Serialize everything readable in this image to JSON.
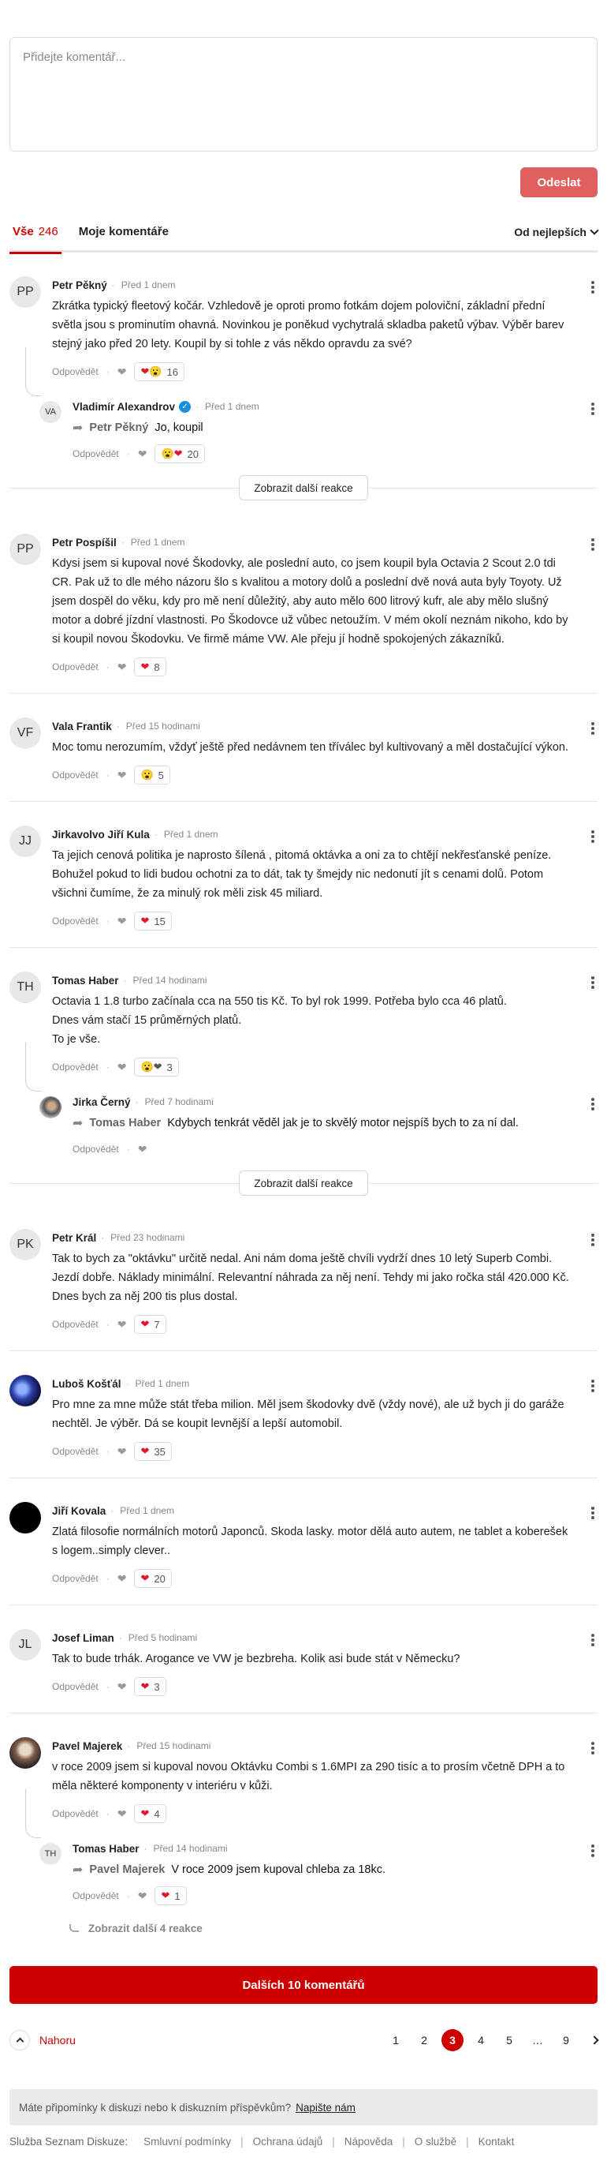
{
  "composer": {
    "placeholder": "Přidejte komentář...",
    "send_label": "Odeslat"
  },
  "tabs": {
    "all_label": "Vše",
    "all_count": "246",
    "mine_label": "Moje komentáře",
    "sort_label": "Od nejlepších"
  },
  "labels": {
    "reply": "Odpovědět",
    "more_reactions": "Zobrazit další reakce",
    "more_replies": "Zobrazit další 4 reakce"
  },
  "threads": [
    {
      "avatar": "PP",
      "name": "Petr Pěkný",
      "time": "Před 1 dnem",
      "text": "Zkrátka typický fleetový kočár. Vzhledově je oproti promo fotkám dojem poloviční, základní přední světla jsou s prominutím ohavná. Novinkou je poněkud vychytralá skladba paketů výbav. Výběr barev stejný jako před 20 lety. Koupil by si tohle z vás někdo opravdu za své?",
      "reaction_emoji": "❤😮",
      "reaction_count": "16",
      "reply": {
        "avatar": "VA",
        "name": "Vladimír Alexandrov",
        "time": "Před 1 dnem",
        "target": "Petr Pěkný",
        "text": "Jo, koupil",
        "reaction_emoji": "😮❤",
        "reaction_count": "20"
      }
    },
    {
      "avatar": "PP",
      "name": "Petr Pospíšil",
      "time": "Před 1 dnem",
      "text": "Kdysi jsem si kupoval nové Škodovky, ale poslední auto, co jsem koupil byla Octavia 2 Scout 2.0 tdi CR. Pak už to dle mého názoru šlo s kvalitou a motory dolů a poslední dvě nová auta byly Toyoty. Už jsem dospěl do věku, kdy pro mě není důležitý, aby auto mělo 600 litrový kufr, ale aby mělo slušný motor a dobré jízdní vlastnosti. Po Škodovce už vůbec netoužím. V mém okolí neznám nikoho, kdo by si koupil novou Škodovku. Ve firmě máme VW. Ale přeju jí hodně spokojených zákazníků.",
      "reaction_emoji": "❤",
      "reaction_count": "8"
    },
    {
      "avatar": "VF",
      "name": "Vala Frantik",
      "time": "Před 15 hodinami",
      "text": "Moc tomu nerozumím, vždyť ještě před nedávnem ten tříválec byl kultivovaný a měl dostačující výkon.",
      "reaction_emoji": "😮",
      "reaction_count": "5"
    },
    {
      "avatar": "JJ",
      "name": "Jirkavolvo Jiří Kula",
      "time": "Před 1 dnem",
      "text": "Ta jejich cenová politika je naprosto šílená , pitomá oktávka a oni za to chtějí nekřesťanské peníze. Bohužel pokud to lidi budou ochotni za to dát, tak ty šmejdy nic nedonutí jít s cenami dolů. Potom všichni čumíme, že za minulý rok měli zisk 45 miliard.",
      "reaction_emoji": "❤",
      "reaction_count": "15"
    },
    {
      "avatar": "TH",
      "name": "Tomas Haber",
      "time": "Před 14 hodinami",
      "text": "Octavia 1 1.8 turbo začínala cca na 550 tis Kč. To byl rok 1999. Potřeba bylo cca 46 platů.\nDnes vám stačí 15 průměrných platů.\nTo je vše.",
      "reaction_emoji": "😮❤",
      "reaction_count": "3",
      "reply": {
        "avatar": "",
        "name": "Jirka Černý",
        "time": "Před 7 hodinami",
        "target": "Tomas Haber",
        "text": "Kdybych tenkrát věděl jak je to skvělý motor nejspíš bych to za ní dal.",
        "reaction_emoji": "",
        "reaction_count": ""
      }
    },
    {
      "avatar": "PK",
      "name": "Petr Král",
      "time": "Před 23 hodinami",
      "text": "Tak to bych za \"oktávku\" určitě nedal. Ani nám doma ještě chvíli vydrží dnes 10 letý Superb Combi. Jezdí dobře. Náklady minimální. Relevantní náhrada za něj není. Tehdy mi jako ročka stál 420.000 Kč. Dnes bych za něj 200 tis plus dostal.",
      "reaction_emoji": "❤",
      "reaction_count": "7"
    },
    {
      "avatar": "",
      "name": "Luboš Košťál",
      "time": "Před 1 dnem",
      "text": "Pro mne za mne může stát třeba milion. Měl jsem škodovky dvě (vždy nové), ale už bych ji do garáže nechtěl. Je výběr. Dá se koupit levnější a lepší automobil.",
      "reaction_emoji": "❤",
      "reaction_count": "35"
    },
    {
      "avatar": "",
      "name": "Jiří Kovala",
      "time": "Před 1 dnem",
      "text": "Zlatá filosofie normálních motorů Japonců. Skoda lasky. motor dělá auto autem, ne tablet a koberešek s logem..simply clever..",
      "reaction_emoji": "❤",
      "reaction_count": "20"
    },
    {
      "avatar": "JL",
      "name": "Josef Liman",
      "time": "Před 5 hodinami",
      "text": "Tak to bude trhák. Arogance ve VW je bezbreha. Kolik asi bude stát v Německu?",
      "reaction_emoji": "❤",
      "reaction_count": "3"
    },
    {
      "avatar": "",
      "name": "Pavel Majerek",
      "time": "Před 15 hodinami",
      "text": "v roce 2009 jsem si kupoval novou Oktávku Combi s 1.6MPI za 290 tisíc a to prosím včetně DPH a to měla některé komponenty v interiéru v kůži.",
      "reaction_emoji": "❤",
      "reaction_count": "4",
      "reply": {
        "avatar": "TH",
        "name": "Tomas Haber",
        "time": "Před 14 hodinami",
        "target": "Pavel Majerek",
        "text": "V roce 2009 jsem kupoval chleba za 18kc.",
        "reaction_emoji": "❤",
        "reaction_count": "1"
      }
    }
  ],
  "load_more_label": "Dalších 10 komentářů",
  "pager": {
    "top_label": "Nahoru",
    "pages": [
      "1",
      "2",
      "3",
      "4",
      "5",
      "…",
      "9"
    ],
    "current": "3"
  },
  "feedback": {
    "text": "Máte připomínky k diskuzi nebo k diskuzním příspěvkům?",
    "link": "Napište nám"
  },
  "footer": {
    "brand": "Služba Seznam Diskuze:",
    "links": [
      "Smluvní podmínky",
      "Ochrana údajů",
      "Nápověda",
      "O službě",
      "Kontakt"
    ]
  },
  "colors": {
    "accent": "#cc0000",
    "send_button": "#e06060",
    "heart": "#e0182d",
    "verified": "#1a8fe0"
  }
}
